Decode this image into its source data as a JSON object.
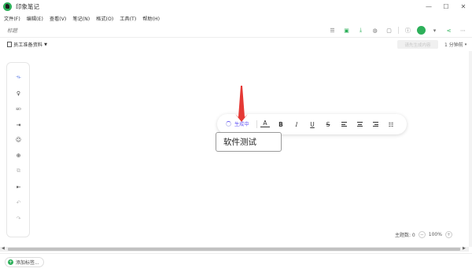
{
  "app": {
    "title": "印象笔记"
  },
  "window": {
    "minimize": "—",
    "maximize": "☐",
    "close": "✕"
  },
  "menu": {
    "items": [
      {
        "label": "文件(F)"
      },
      {
        "label": "编辑(E)"
      },
      {
        "label": "查看(V)"
      },
      {
        "label": "笔记(N)"
      },
      {
        "label": "格式(O)"
      },
      {
        "label": "工具(T)"
      },
      {
        "label": "帮助(H)"
      }
    ]
  },
  "note": {
    "title_placeholder": "标题"
  },
  "top_icons": [
    "list-icon",
    "evernote-doc-icon",
    "download-icon",
    "globe-icon",
    "comment-icon",
    "info-icon",
    "avatar",
    "chevron-down-icon",
    "share-icon",
    "more-icon"
  ],
  "toolbar": {
    "structure_label": "员工准备资料",
    "disabled_button": "请先生成内容",
    "reading_time": "1 分钟前"
  },
  "left_tools": [
    "mindmap-icon",
    "bulb-icon",
    "branch-icon",
    "insert-child-icon",
    "emoji-icon",
    "add-circle-icon",
    "duplicate-icon",
    "insert-sibling-icon",
    "undo-icon",
    "redo-icon"
  ],
  "format_bar": {
    "generating_label": "生成中",
    "font_color": "A",
    "bold": "B",
    "italic": "I",
    "underline": "U",
    "strike": "S"
  },
  "node": {
    "text": "软件测试"
  },
  "zoom": {
    "topic_count_label": "主题数: 0",
    "minus": "−",
    "value": "100%",
    "plus": "+"
  },
  "footer": {
    "add_tag_label": "添加标签..."
  },
  "colors": {
    "brand_green": "#2db05a",
    "generating_purple": "#6a5cf6",
    "annotation_red": "#e53935"
  }
}
